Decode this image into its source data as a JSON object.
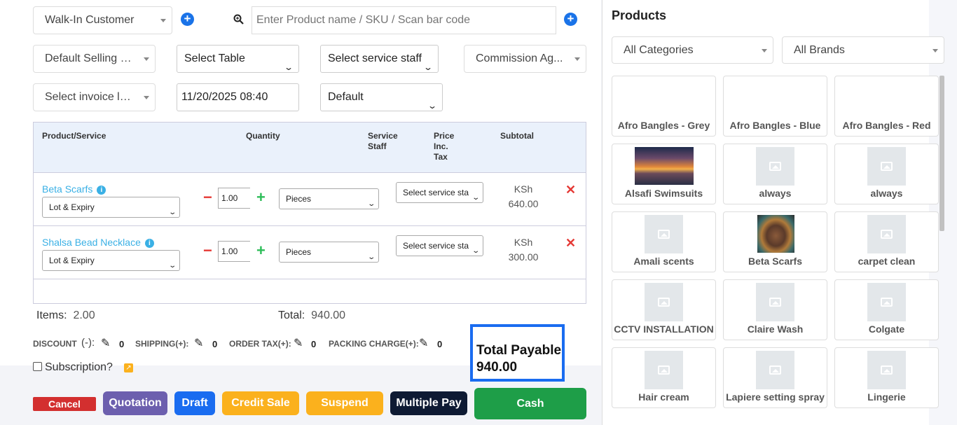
{
  "customer": {
    "value": "Walk-In Customer"
  },
  "search": {
    "placeholder": "Enter Product name / SKU / Scan bar code"
  },
  "filters": {
    "selling_price": "Default Selling P...",
    "table": "Select Table",
    "service_staff": "Select service staff",
    "commission_agent": "Commission Ag...",
    "invoice_layout": "Select invoice la...",
    "datetime": "11/20/2025 08:40",
    "invoice_scheme": "Default"
  },
  "table": {
    "headers": {
      "product": "Product/Service",
      "quantity": "Quantity",
      "service_staff_1": "Service",
      "service_staff_2": "Staff",
      "price_1": "Price",
      "price_2": "Inc.",
      "price_3": "Tax",
      "subtotal": "Subtotal"
    },
    "rows": [
      {
        "name": "Beta Scarfs",
        "lot": "Lot & Expiry",
        "qty": "1.00",
        "unit": "Pieces",
        "staff": "Select service sta",
        "currency": "KSh",
        "subtotal": "640.00"
      },
      {
        "name": "Shalsa Bead Necklace",
        "lot": "Lot & Expiry",
        "qty": "1.00",
        "unit": "Pieces",
        "staff": "Select service sta",
        "currency": "KSh",
        "subtotal": "300.00"
      }
    ]
  },
  "summary": {
    "items_label": "Items:",
    "items_value": "2.00",
    "total_label": "Total:",
    "total_value": "940.00",
    "discount_label": "DISCOUNT",
    "discount_sign": "(-):",
    "discount_value": "0",
    "shipping_label": "SHIPPING(+):",
    "shipping_value": "0",
    "tax_label": "ORDER TAX(+):",
    "tax_value": "0",
    "packing_label": "PACKING CHARGE(+):",
    "packing_value": "0",
    "subscription_label": "Subscription?",
    "total_payable_label": "Total Payable",
    "total_payable_value": "940.00"
  },
  "buttons": {
    "cancel": "Cancel",
    "quotation": "Quotation",
    "draft": "Draft",
    "credit_sale": "Credit Sale",
    "suspend": "Suspend",
    "multiple_pay": "Multiple Pay",
    "cash": "Cash"
  },
  "products_panel": {
    "title": "Products",
    "category": "All Categories",
    "brand": "All Brands",
    "items": [
      {
        "name": "Afro Bangles - Grey",
        "image": "none"
      },
      {
        "name": "Afro Bangles - Blue",
        "image": "none"
      },
      {
        "name": "Afro Bangles - Red",
        "image": "none"
      },
      {
        "name": "Alsafi Swimsuits",
        "image": "sunset-photo"
      },
      {
        "name": "always",
        "image": "placeholder"
      },
      {
        "name": "always",
        "image": "placeholder"
      },
      {
        "name": "Amali scents",
        "image": "placeholder"
      },
      {
        "name": "Beta Scarfs",
        "image": "portrait-photo"
      },
      {
        "name": "carpet clean",
        "image": "placeholder"
      },
      {
        "name": "CCTV INSTALLATION",
        "image": "placeholder"
      },
      {
        "name": "Claire Wash",
        "image": "placeholder"
      },
      {
        "name": "Colgate",
        "image": "placeholder"
      },
      {
        "name": "Hair cream",
        "image": "placeholder"
      },
      {
        "name": "Lapiere setting spray",
        "image": "placeholder"
      },
      {
        "name": "Lingerie",
        "image": "placeholder"
      }
    ]
  },
  "colors": {
    "cancel": "#d32f2f",
    "quotation": "#6c5fae",
    "draft": "#1a6cf0",
    "credit_sale": "#fbb11d",
    "suspend": "#fbb11d",
    "multiple_pay": "#0e1a33",
    "cash": "#1e9e48"
  }
}
